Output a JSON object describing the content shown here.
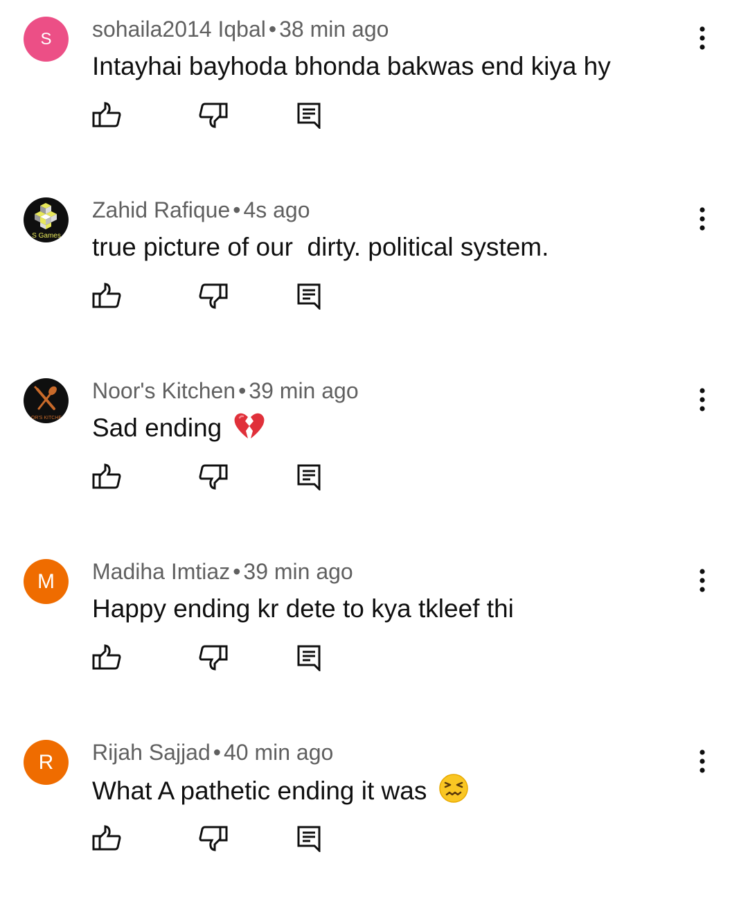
{
  "colors": {
    "meta_text": "#606060",
    "comment_text": "#0f0f0f",
    "icon": "#0f0f0f",
    "avatar_s": "#ec4f86",
    "avatar_m": "#ef6c00",
    "avatar_r": "#ef6c00",
    "avatar_dark": "#0f0f0f",
    "avatar_accent": "#e8e85a"
  },
  "comments": [
    {
      "author": "sohaila2014 Iqbal",
      "separator": "•",
      "time": "38 min ago",
      "text": "Intayhai bayhoda bhonda bakwas end kiya hy",
      "avatar": {
        "type": "letter",
        "letter": "S"
      }
    },
    {
      "author": "Zahid Rafique",
      "separator": "•",
      "time": "4s ago",
      "text": "true picture of our  dirty. political system.",
      "avatar": {
        "type": "image",
        "icon": "cube-logo-icon",
        "label": "S Games"
      }
    },
    {
      "author": "Noor's Kitchen",
      "separator": "•",
      "time": "39 min ago",
      "text": "Sad ending",
      "emoji": "broken-heart-icon",
      "avatar": {
        "type": "image",
        "icon": "kitchen-utensils-icon",
        "label": "OR'S KITCHE"
      }
    },
    {
      "author": "Madiha Imtiaz",
      "separator": "•",
      "time": "39 min ago",
      "text": "Happy ending kr dete to kya tkleef thi",
      "avatar": {
        "type": "letter",
        "letter": "M"
      }
    },
    {
      "author": "Rijah Sajjad",
      "separator": "•",
      "time": "40 min ago",
      "text": "What A pathetic ending it was",
      "emoji": "confounded-face-icon",
      "avatar": {
        "type": "letter",
        "letter": "R"
      }
    }
  ]
}
